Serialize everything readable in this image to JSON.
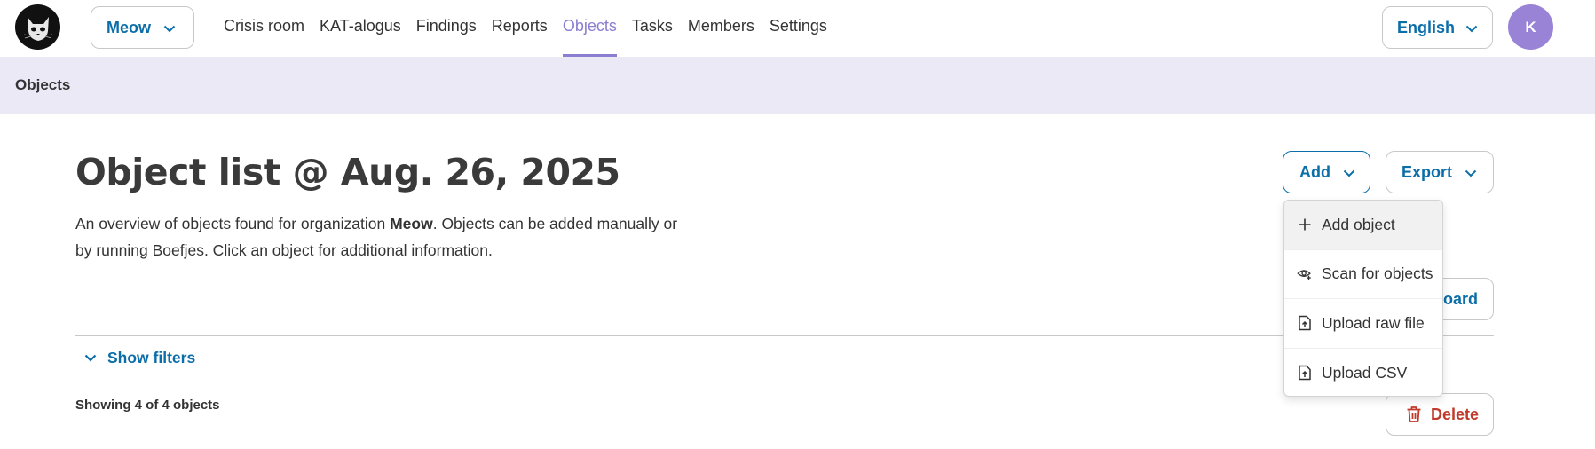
{
  "header": {
    "organization": "Meow",
    "nav": [
      {
        "label": "Crisis room",
        "active": false
      },
      {
        "label": "KAT-alogus",
        "active": false
      },
      {
        "label": "Findings",
        "active": false
      },
      {
        "label": "Reports",
        "active": false
      },
      {
        "label": "Objects",
        "active": true
      },
      {
        "label": "Tasks",
        "active": false
      },
      {
        "label": "Members",
        "active": false
      },
      {
        "label": "Settings",
        "active": false
      }
    ],
    "language": "English",
    "avatar_initial": "K"
  },
  "breadcrumb": {
    "current": "Objects"
  },
  "main": {
    "title": "Object list @ Aug. 26, 2025",
    "intro_before": "An overview of objects found for organization ",
    "intro_org": "Meow",
    "intro_after": ". Objects can be added manually or by running Boefjes. Click an object for additional information.",
    "add_label": "Add",
    "export_label": "Export",
    "dashboard_label_visible": "oard",
    "show_filters_label": "Show filters",
    "count_text": "Showing 4 of 4 objects",
    "delete_label": "Delete"
  },
  "add_menu": {
    "items": [
      {
        "label": "Add object",
        "icon": "plus-icon",
        "highlighted": true
      },
      {
        "label": "Scan for objects",
        "icon": "eye-scan-icon",
        "highlighted": false
      },
      {
        "label": "Upload raw file",
        "icon": "file-upload-icon",
        "highlighted": false
      },
      {
        "label": "Upload CSV",
        "icon": "file-upload-icon",
        "highlighted": false
      }
    ]
  },
  "colors": {
    "accent_blue": "#0b6ea8",
    "nav_active": "#8b7dcf",
    "breadcrumb_bg": "#ece9f6",
    "avatar_bg": "#9983d6",
    "danger": "#c0392b"
  }
}
